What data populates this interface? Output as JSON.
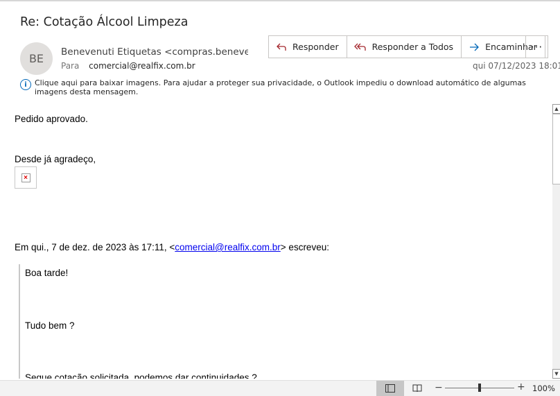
{
  "email": {
    "subject": "Re: Cotação Álcool Limpeza",
    "avatar_initials": "BE",
    "sender": "Benevenuti Etiquetas <compras.benevenuti",
    "to_label": "Para",
    "to_value": "comercial@realfix.com.br",
    "date": "qui 07/12/2023 18:01",
    "info_text": "Clique aqui para baixar imagens. Para ajudar a proteger sua privacidade, o Outlook impediu o download automático de algumas imagens desta mensagem."
  },
  "actions": {
    "reply": "Responder",
    "reply_all": "Responder a Todos",
    "forward": "Encaminhar",
    "more": "···"
  },
  "body": {
    "line1": "Pedido aprovado.",
    "line2": "Desde já agradeço,",
    "quote_header_prefix": "Em qui., 7 de dez. de 2023 às 17:11, <",
    "quote_header_email": "comercial@realfix.com.br",
    "quote_header_suffix": "> escreveu:",
    "quote_line1": "Boa tarde!",
    "quote_line2": "Tudo bem ?",
    "quote_line3": "Segue cotação solicitada, podemos dar continuidades ?"
  },
  "statusbar": {
    "zoom": "100%",
    "zoom_minus": "−",
    "zoom_plus": "+"
  },
  "colors": {
    "accent": "#0067b8",
    "link": "#0000ee"
  }
}
